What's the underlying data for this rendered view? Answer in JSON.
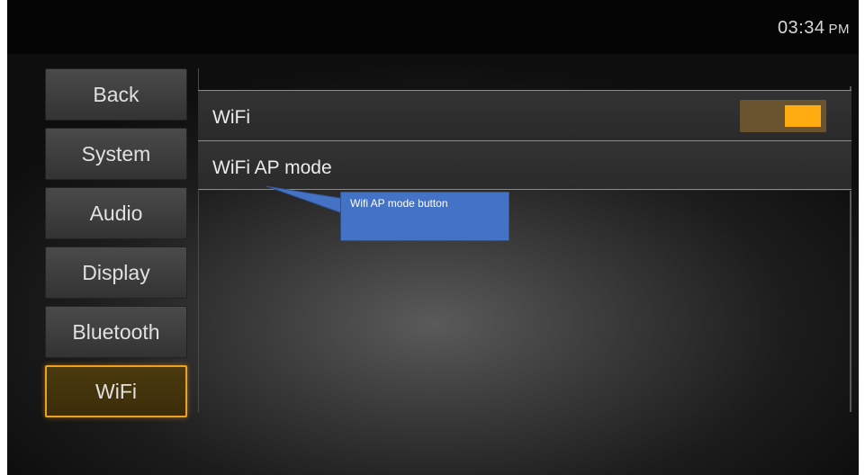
{
  "status_bar": {
    "time": "03:34",
    "ampm": "PM"
  },
  "sidebar": {
    "items": [
      {
        "label": "Back"
      },
      {
        "label": "System"
      },
      {
        "label": "Audio"
      },
      {
        "label": "Display"
      },
      {
        "label": "Bluetooth"
      },
      {
        "label": "WiFi",
        "selected": true
      }
    ]
  },
  "settings": {
    "rows": [
      {
        "label": "WiFi",
        "toggle": {
          "state": "on",
          "color": "#ffac10"
        }
      },
      {
        "label": "WiFi AP mode"
      }
    ]
  },
  "annotation": {
    "text": "Wifi AP mode button",
    "color": "#4472c4"
  }
}
